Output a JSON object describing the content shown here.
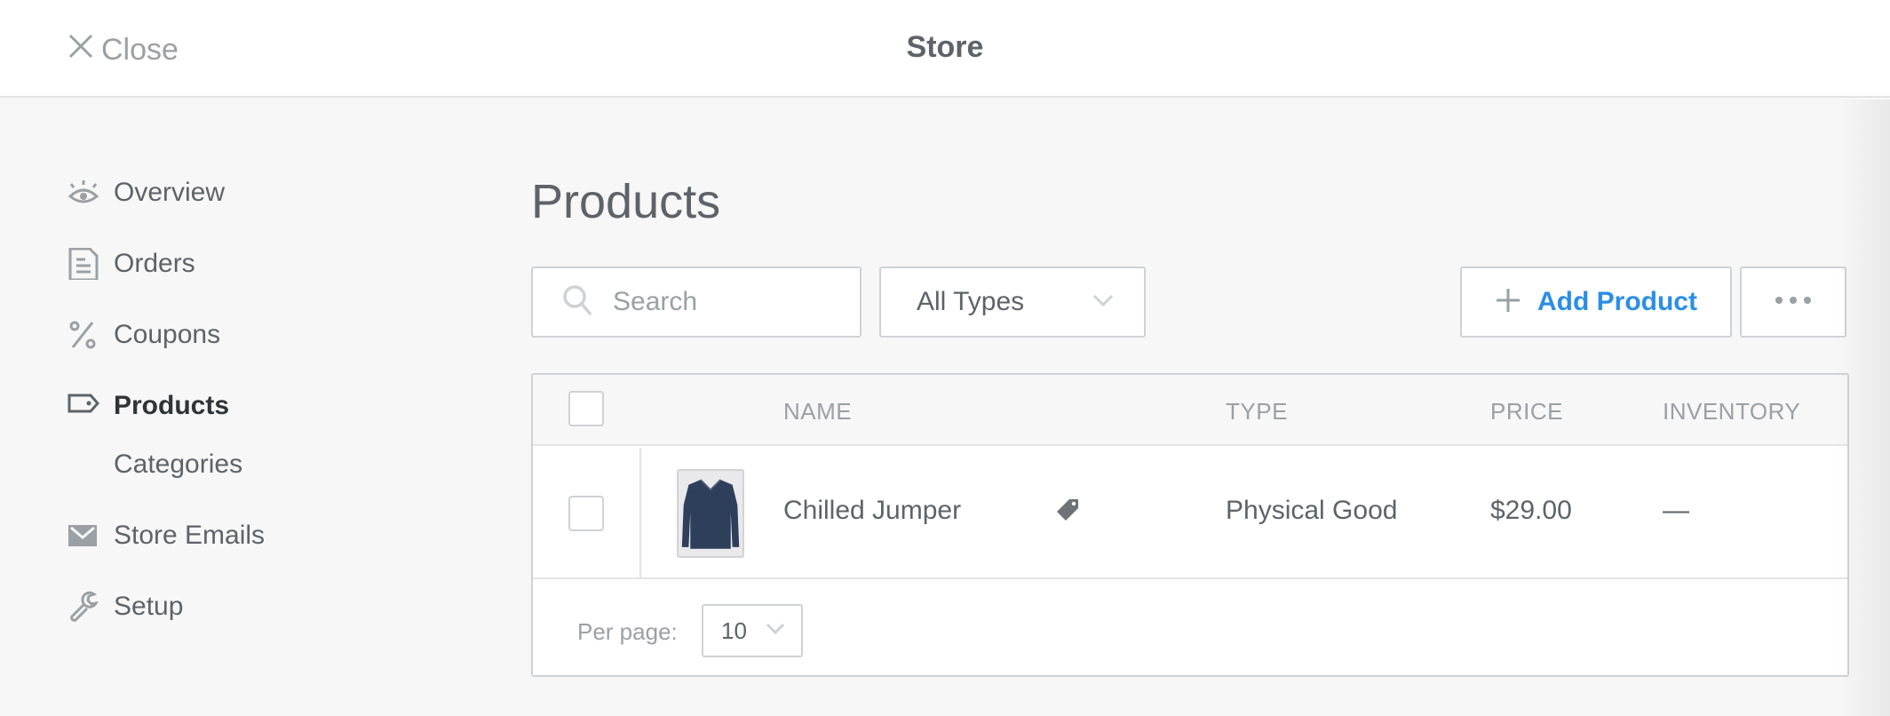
{
  "header": {
    "close_label": "Close",
    "title": "Store"
  },
  "sidebar": {
    "items": [
      {
        "label": "Overview",
        "icon": "eye-icon",
        "active": false
      },
      {
        "label": "Orders",
        "icon": "document-icon",
        "active": false
      },
      {
        "label": "Coupons",
        "icon": "percent-icon",
        "active": false
      },
      {
        "label": "Products",
        "icon": "tag-icon",
        "active": true
      },
      {
        "label": "Categories",
        "icon": null,
        "active": false,
        "sub": true
      },
      {
        "label": "Store Emails",
        "icon": "envelope-icon",
        "active": false
      },
      {
        "label": "Setup",
        "icon": "wrench-icon",
        "active": false
      }
    ]
  },
  "main": {
    "title": "Products",
    "search": {
      "placeholder": "Search",
      "value": ""
    },
    "type_filter": {
      "selected": "All Types"
    },
    "add_button": {
      "label": "Add Product"
    },
    "more_button": {
      "icon": "ellipsis-icon"
    },
    "table": {
      "columns": [
        "NAME",
        "TYPE",
        "PRICE",
        "INVENTORY"
      ],
      "rows": [
        {
          "name": "Chilled Jumper",
          "type": "Physical Good",
          "price": "$29.00",
          "inventory": "—",
          "has_tag": true,
          "thumbnail": "navy sweater"
        }
      ],
      "per_page_label": "Per page:",
      "per_page_value": "10"
    }
  },
  "colors": {
    "accent": "#2b8ee6",
    "text": "#5d6369",
    "muted": "#9aa0a4",
    "border": "#cfd2d5",
    "background": "#f7f7f7"
  }
}
